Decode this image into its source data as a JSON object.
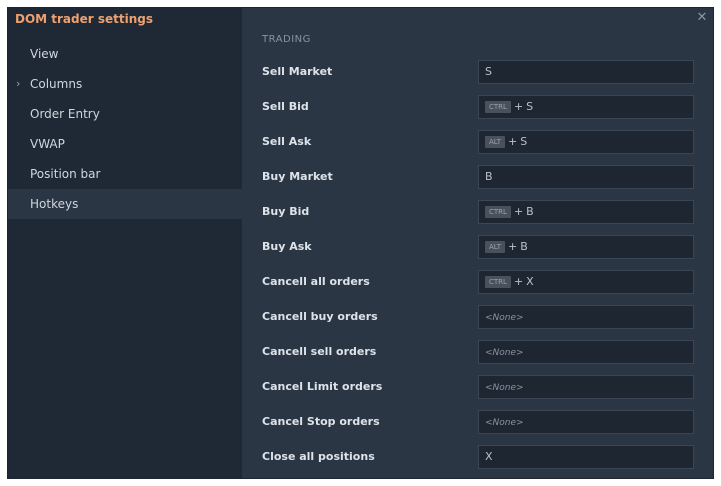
{
  "window": {
    "title": "DOM trader settings",
    "close_glyph": "✕"
  },
  "sidebar": {
    "items": [
      {
        "label": "View"
      },
      {
        "label": "Columns",
        "chevron": "›"
      },
      {
        "label": "Order Entry"
      },
      {
        "label": "VWAP"
      },
      {
        "label": "Position bar"
      },
      {
        "label": "Hotkeys",
        "active": true
      }
    ]
  },
  "section": {
    "title": "TRADING"
  },
  "hotkeys": {
    "plus": "+",
    "rows": [
      {
        "label": "Sell Market",
        "key": "S"
      },
      {
        "label": "Sell Bid",
        "modifier": "CTRL",
        "key": "S"
      },
      {
        "label": "Sell Ask",
        "modifier": "ALT",
        "key": "S"
      },
      {
        "label": "Buy Market",
        "key": "B"
      },
      {
        "label": "Buy Bid",
        "modifier": "CTRL",
        "key": "B"
      },
      {
        "label": "Buy Ask",
        "modifier": "ALT",
        "key": "B"
      },
      {
        "label": "Cancell all orders",
        "modifier": "CTRL",
        "key": "X"
      },
      {
        "label": "Cancell buy orders",
        "none": "<None>"
      },
      {
        "label": "Cancell sell orders",
        "none": "<None>"
      },
      {
        "label": "Cancel Limit orders",
        "none": "<None>"
      },
      {
        "label": "Cancel Stop orders",
        "none": "<None>"
      },
      {
        "label": "Close all positions",
        "key": "X"
      }
    ]
  },
  "colors": {
    "title_accent": "#f0a070",
    "window_bg": "#2b3644",
    "sidebar_bg": "#1f2935",
    "field_bg": "#1d2631"
  },
  "icons": {
    "close": "close-icon",
    "chevron": "chevron-right-icon"
  }
}
